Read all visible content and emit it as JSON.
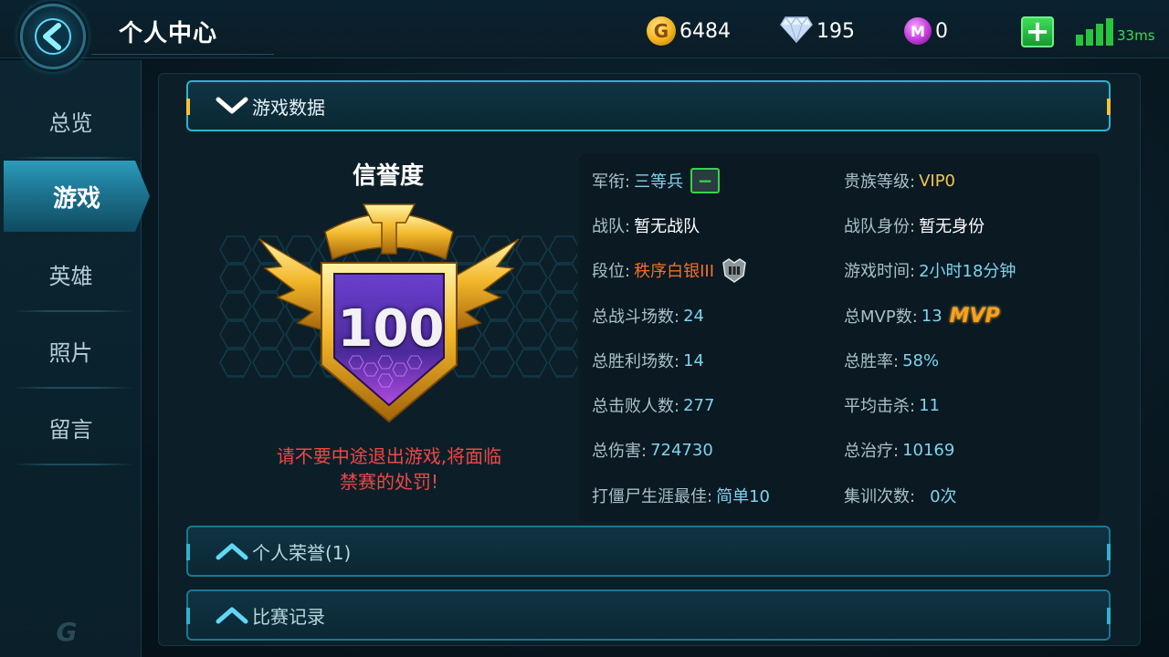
{
  "header": {
    "title": "个人中心",
    "gold": "6484",
    "diamonds": "195",
    "gems": "0",
    "latency": "33ms",
    "coin_letter": "G",
    "gem_letter": "M"
  },
  "sidebar": {
    "items": [
      {
        "label": "总览",
        "active": false
      },
      {
        "label": "游戏",
        "active": true
      },
      {
        "label": "英雄",
        "active": false
      },
      {
        "label": "照片",
        "active": false
      },
      {
        "label": "留言",
        "active": false
      }
    ]
  },
  "sections": {
    "game_data": "游戏数据",
    "honors": "个人荣誉(1)",
    "match_history": "比赛记录"
  },
  "credit": {
    "title": "信誉度",
    "score": "100",
    "warning_line1": "请不要中途退出游戏,将面临",
    "warning_line2": "禁赛的处罚!"
  },
  "stats": {
    "military_rank_label": "军衔:",
    "military_rank": "三等兵",
    "noble_level_label": "贵族等级:",
    "noble_level": "VIP0",
    "team_label": "战队:",
    "team": "暂无战队",
    "team_role_label": "战队身份:",
    "team_role": "暂无身份",
    "tier_label": "段位:",
    "tier": "秩序白银III",
    "playtime_label": "游戏时间:",
    "playtime": "2小时18分钟",
    "total_matches_label": "总战斗场数:",
    "total_matches": "24",
    "total_mvp_label": "总MVP数:",
    "total_mvp": "13",
    "mvp_badge": "MVP",
    "total_wins_label": "总胜利场数:",
    "total_wins": "14",
    "win_rate_label": "总胜率:",
    "win_rate": "58%",
    "total_kills_label": "总击败人数:",
    "total_kills": "277",
    "avg_kills_label": "平均击杀:",
    "avg_kills": "11",
    "total_damage_label": "总伤害:",
    "total_damage": "724730",
    "total_healing_label": "总治疗:",
    "total_healing": "10169",
    "zombie_best_label": "打僵尸生涯最佳:",
    "zombie_best": "简单10",
    "training_label": "集训次数:",
    "training": "0次"
  },
  "colors": {
    "accent": "#2fb3cf",
    "warning": "#f04646",
    "value": "#7ed4ee",
    "tier": "#f0712a",
    "vip": "#f3c64b"
  }
}
